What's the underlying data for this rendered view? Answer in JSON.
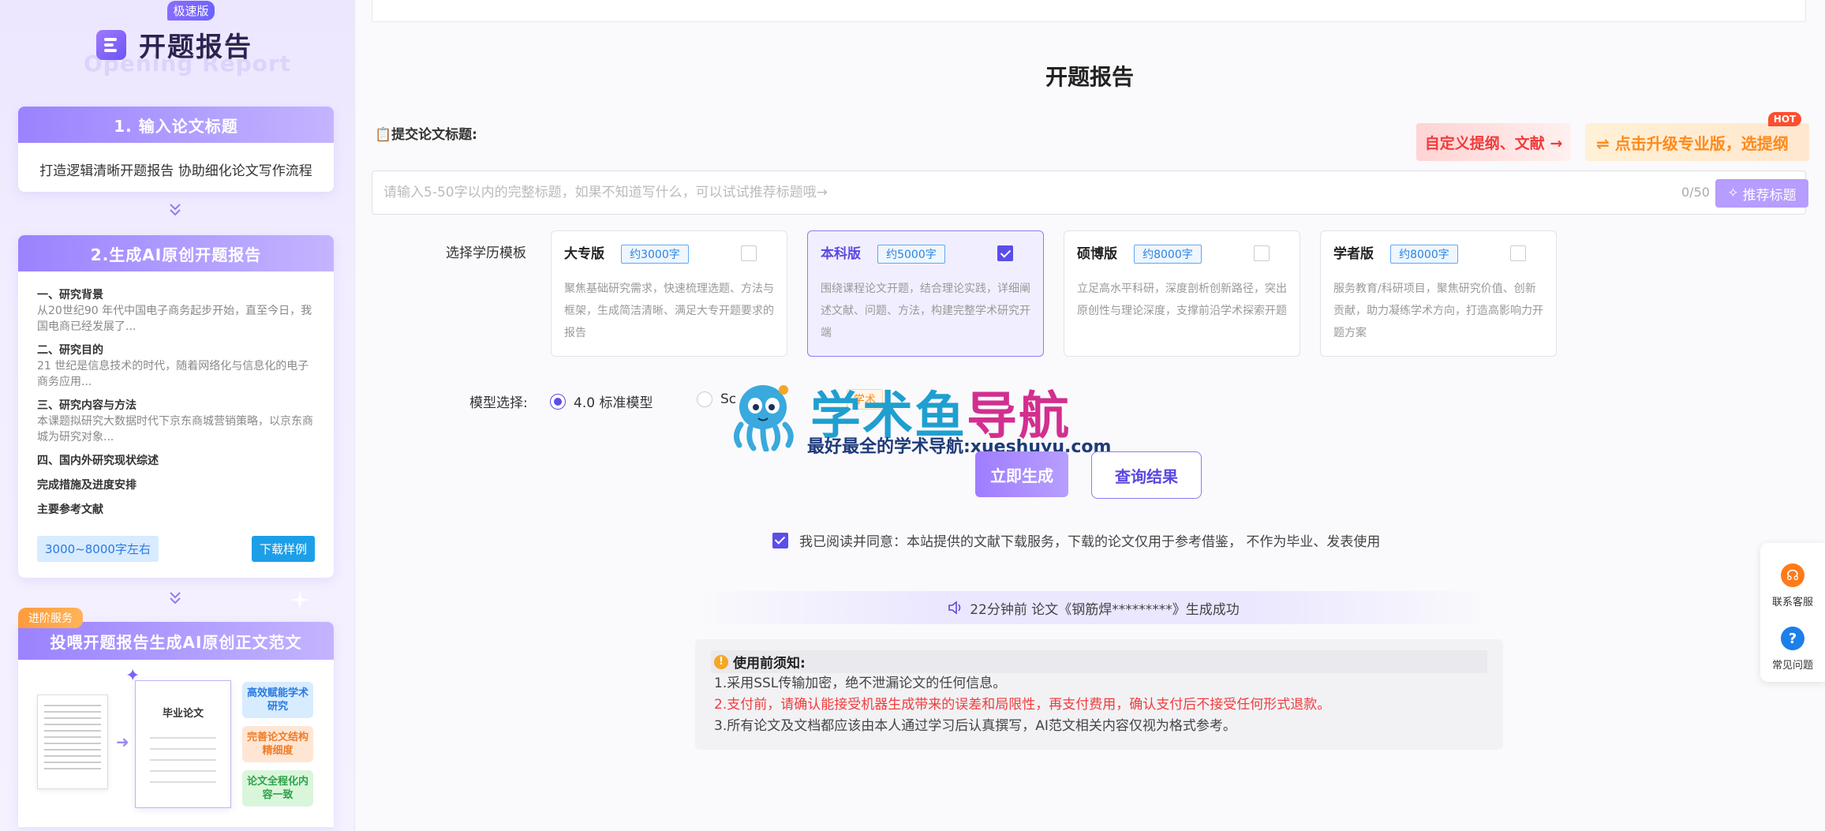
{
  "sidebar": {
    "speed_badge": "极速版",
    "brand_title": "开题报告",
    "brand_subtitle": "Opening Report",
    "step1": {
      "title": "1. 输入论文标题",
      "text": "打造逻辑清晰开题报告 协助细化论文写作流程"
    },
    "step2": {
      "title": "2.生成AI原创开题报告",
      "outline": [
        {
          "heading": "一、研究背景",
          "text": "从20世纪90 年代中国电子商务起步开始，直至今日，我国电商已经发展了..."
        },
        {
          "heading": "二、研究目的",
          "text": "21 世纪是信息技术的时代，随着网络化与信息化的电子商务应用..."
        },
        {
          "heading": "三、研究内容与方法",
          "text": "本课题拟研究大数据时代下京东商城营销策略，以京东商城为研究对象..."
        }
      ],
      "extra_headings": [
        "四、国内外研究现状综述",
        "完成措施及进度安排",
        "主要参考文献"
      ],
      "range_tag": "3000~8000字左右",
      "download_button": "下载样例"
    },
    "step3": {
      "badge": "进阶服务",
      "title": "投喂开题报告生成AI原创正文范文",
      "paper_label": "毕业论文",
      "features": [
        "高效赋能学术研究",
        "完善论文结构精细度",
        "论文全程化内容一致"
      ]
    }
  },
  "main": {
    "page_title": "开题报告",
    "submit_label": "📋提交论文标题:",
    "promo_left": "自定义提纲、文献 →",
    "promo_right": "⇌ 点击升级专业版，选提纲",
    "hot_badge": "HOT",
    "title_input": {
      "value": "",
      "placeholder": "请输入5-50字以内的完整标题，如果不知道写什么，可以试试推荐标题哦→",
      "counter": "0/50",
      "suggest_button": "推荐标题"
    },
    "template_label": "选择学历模板",
    "templates": [
      {
        "name": "大专版",
        "words": "约3000字",
        "checked": false,
        "desc": "聚焦基础研究需求，快速梳理选题、方法与框架，生成简洁清晰、满足大专开题要求的报告"
      },
      {
        "name": "本科版",
        "words": "约5000字",
        "checked": true,
        "desc": "围绕课程论文开题，结合理论实践，详细阐述文献、问题、方法，构建完整学术研究开端"
      },
      {
        "name": "硕博版",
        "words": "约8000字",
        "checked": false,
        "desc": "立足高水平科研，深度剖析创新路径，突出原创性与理论深度，支撑前沿学术探索开题"
      },
      {
        "name": "学者版",
        "words": "约8000字",
        "checked": false,
        "desc": "服务教育/科研项目，聚焦研究价值、创新贡献，助力凝练学术方向，打造高影响力开题方案"
      }
    ],
    "model_label": "模型选择:",
    "models": [
      {
        "name": "4.0 标准模型",
        "selected": true
      },
      {
        "name": "Sc",
        "selected": false
      }
    ],
    "model_beta_tag": "学术",
    "watermark": {
      "title_a": "学术",
      "title_b": "鱼",
      "title_c": "导航",
      "subtitle": "最好最全的学术导航:xueshuyu.com"
    },
    "generate_button": "立即生成",
    "query_button": "查询结果",
    "agreement": "我已阅读并同意：本站提供的文献下载服务，下载的论文仅用于参考借鉴， 不作为毕业、发表使用",
    "ticker": "22分钟前 论文《钢筋焊*********》生成成功",
    "notice": {
      "title": "使用前须知:",
      "lines": [
        "1.采用SSL传输加密，绝不泄漏论文的任何信息。",
        "2.支付前，请确认能接受机器生成带来的误差和局限性，再支付费用，确认支付后不接受任何形式退款。",
        "3.所有论文及文档都应该由本人通过学习后认真撰写，AI范文相关内容仅视为格式参考。"
      ]
    }
  },
  "float_panel": {
    "contact": "联系客服",
    "faq": "常见问题"
  },
  "colors": {
    "accent": "#5b4ee8",
    "accent_light": "#9b82ff",
    "danger": "#f03c3c",
    "warning": "#ff8a1a"
  }
}
